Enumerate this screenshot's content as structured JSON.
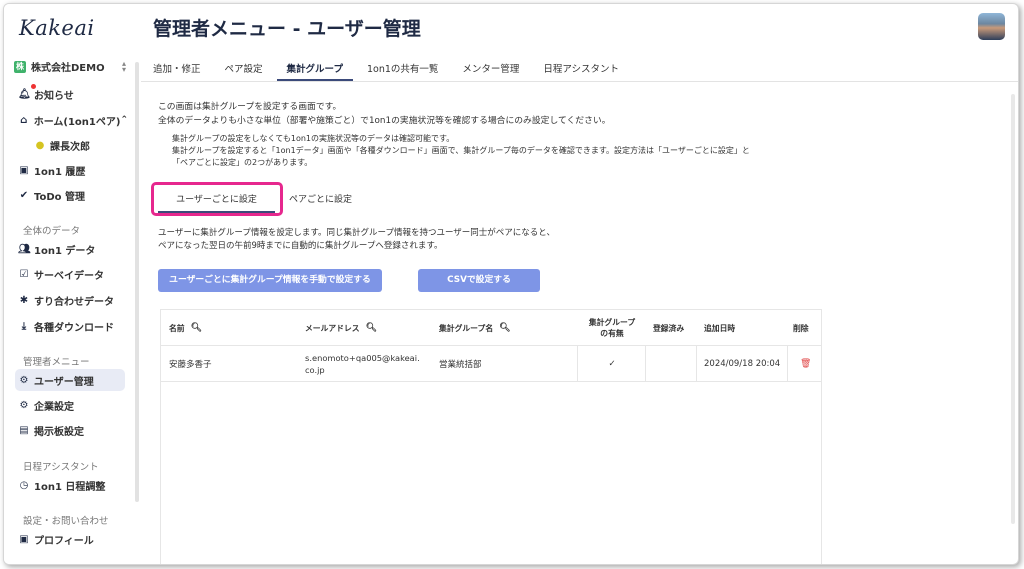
{
  "app": {
    "logo": "Kakeai"
  },
  "sidebar": {
    "company": {
      "badge": "株",
      "name": "株式会社DEMO"
    },
    "items": [
      {
        "label": "お知らせ",
        "icon": "bell-icon"
      },
      {
        "label": "ホーム(1on1ペア)",
        "icon": "home-icon"
      },
      {
        "label": "課長次郎",
        "icon": "user-icon"
      },
      {
        "label": "1on1 履歴",
        "icon": "history-icon"
      },
      {
        "label": "ToDo 管理",
        "icon": "check-circle-icon"
      }
    ],
    "section_all": "全体のデータ",
    "items_all": [
      {
        "label": "1on1 データ",
        "icon": "users-icon"
      },
      {
        "label": "サーベイデータ",
        "icon": "survey-icon"
      },
      {
        "label": "すり合わせデータ",
        "icon": "puzzle-icon"
      },
      {
        "label": "各種ダウンロード",
        "icon": "download-icon"
      }
    ],
    "section_admin": "管理者メニュー",
    "items_admin": [
      {
        "label": "ユーザー管理",
        "icon": "user-manage-icon"
      },
      {
        "label": "企業設定",
        "icon": "company-settings-icon"
      },
      {
        "label": "掲示板設定",
        "icon": "board-icon"
      }
    ],
    "section_schedule": "日程アシスタント",
    "items_schedule": [
      {
        "label": "1on1 日程調整",
        "icon": "clock-icon"
      }
    ],
    "section_settings": "設定・お問い合わせ",
    "items_settings": [
      {
        "label": "プロフィール",
        "icon": "profile-icon"
      }
    ]
  },
  "header": {
    "title": "管理者メニュー - ユーザー管理"
  },
  "tabs": [
    {
      "label": "追加・修正"
    },
    {
      "label": "ペア設定"
    },
    {
      "label": "集計グループ"
    },
    {
      "label": "1on1の共有一覧"
    },
    {
      "label": "メンター管理"
    },
    {
      "label": "日程アシスタント"
    }
  ],
  "description": {
    "line1": "この画面は集計グループを設定する画面です。",
    "line2": "全体のデータよりも小さな単位（部署や施策ごと）で1on1の実施状況等を確認する場合にのみ設定してください。",
    "note1": "集計グループの設定をしなくても1on1の実施状況等のデータは確認可能です。",
    "note2": "集計グループを設定すると「1on1データ」画面や「各種ダウンロード」画面で、集計グループ毎のデータを確認できます。設定方法は「ユーザーごとに設定」と",
    "note3": "「ペアごとに設定」の2つがあります。"
  },
  "subtabs": [
    {
      "label": "ユーザーごとに設定"
    },
    {
      "label": "ペアごとに設定"
    }
  ],
  "subdesc": {
    "line1": "ユーザーに集計グループ情報を設定します。同じ集計グループ情報を持つユーザー同士がペアになると、",
    "line2": "ペアになった翌日の午前9時までに自動的に集計グループへ登録されます。"
  },
  "buttons": {
    "manual": "ユーザーごとに集計グループ情報を手動で設定する",
    "csv": "CSVで設定する"
  },
  "table": {
    "columns": {
      "name": "名前",
      "email": "メールアドレス",
      "group": "集計グループ名",
      "has_group_1": "集計グループ",
      "has_group_2": "の有無",
      "registered": "登録済み",
      "added": "追加日時",
      "delete": "削除"
    },
    "rows": [
      {
        "name": "安藤多香子",
        "email_1": "s.enomoto+qa005@kakeai.",
        "email_2": "co.jp",
        "group": "営業統括部",
        "has_group": "✓",
        "registered": "",
        "added": "2024/09/18 20:04",
        "delete_icon": "trash-icon"
      }
    ]
  },
  "colors": {
    "accent": "#7e95e6",
    "highlight": "#e6288e",
    "navy": "#1f2a44",
    "delete": "#e04545"
  }
}
